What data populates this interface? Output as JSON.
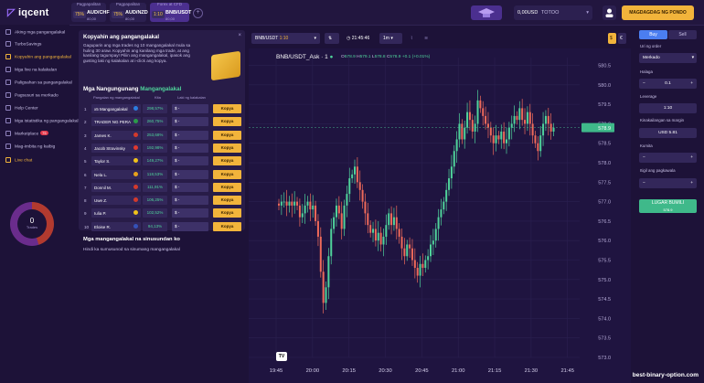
{
  "brand": {
    "name": "iqcent"
  },
  "asset_tabs": [
    {
      "header": "Pagpapalitan",
      "percent": "75%",
      "name": "AUD/CHF",
      "sub": "80,00"
    },
    {
      "header": "Pagpapalitan",
      "percent": "75%",
      "name": "AUD/NZD",
      "sub": "80,00"
    },
    {
      "header": "Forex at CFD",
      "percent": "1:10",
      "name": "BNB/USDT",
      "sub": "80,00"
    }
  ],
  "balance": {
    "amount": "0,00USD",
    "type": "TOTOO"
  },
  "deposit_label": "MAGDAGDAG NG PONDO",
  "sidebar": {
    "items": [
      {
        "label": "Aking mga pangangalakal"
      },
      {
        "label": "TurboSavings"
      },
      {
        "label": "Kopyahin ang pangangalakal",
        "highlight": true
      },
      {
        "label": "Mga live na kalakalan"
      },
      {
        "label": "Paligsahan sa pangangalakal"
      },
      {
        "label": "Pagsusuri sa merkado"
      },
      {
        "label": "Help Center"
      },
      {
        "label": "Mga istatistika ng pangangalakal"
      },
      {
        "label": "Marketplace",
        "badge": "75"
      },
      {
        "label": "Mag-imbita ng kaibig"
      },
      {
        "label": "Live chat",
        "highlight": true
      }
    ],
    "trades_count": "0",
    "trades_label": "Trades"
  },
  "copy_panel": {
    "title": "Kopyahin ang pangangalakal",
    "description": "Gaguparin ang mga trades ng 10 mangangalakal mula sa huling 30 araw. Kopyahin ang kanilang mga trade, at ang kanilang tagumpay! Piliin ang mangangalakal, ipasok ang gusting laki ng kalakalan at i-click ang kopya.",
    "top_title": "Mga Nangungunang",
    "top_title_accent": "Mangangalakal",
    "columns": [
      "Pangalan ng mangangalakal",
      "Kita",
      "Laki ng kalakalan"
    ],
    "rows": [
      {
        "rank": "1",
        "name": "x5 Mangangalakal",
        "flag_color": "#2b7de0",
        "pct": "298,57%",
        "amount": "$ -",
        "copy": "Kopya"
      },
      {
        "rank": "2",
        "name": "TRADER NG PERA",
        "flag_color": "#2b9a4a",
        "pct": "260,75%",
        "amount": "$ -",
        "copy": "Kopya"
      },
      {
        "rank": "3",
        "name": "James K.",
        "flag_color": "#d33a2c",
        "pct": "253,68%",
        "amount": "$ -",
        "copy": "Kopya"
      },
      {
        "rank": "4",
        "name": "Jacob Stravinsky",
        "flag_color": "#e0392f",
        "pct": "192,98%",
        "amount": "$ -",
        "copy": "Kopya"
      },
      {
        "rank": "5",
        "name": "Taylor S.",
        "flag_color": "#f0c21a",
        "pct": "149,27%",
        "amount": "$ -",
        "copy": "Kopya"
      },
      {
        "rank": "6",
        "name": "Nela L.",
        "flag_color": "#e8a21c",
        "pct": "118,53%",
        "amount": "$ -",
        "copy": "Kopya"
      },
      {
        "rank": "7",
        "name": "Donnil M.",
        "flag_color": "#d33a2c",
        "pct": "111,91%",
        "amount": "$ -",
        "copy": "Kopya"
      },
      {
        "rank": "8",
        "name": "Uwe Z.",
        "flag_color": "#d33a2c",
        "pct": "106,25%",
        "amount": "$ -",
        "copy": "Kopya"
      },
      {
        "rank": "9",
        "name": "Iulia P.",
        "flag_color": "#f0c21a",
        "pct": "102,52%",
        "amount": "$ -",
        "copy": "Kopya"
      },
      {
        "rank": "10",
        "name": "Eloise R.",
        "flag_color": "#3552b8",
        "pct": "94,13%",
        "amount": "$ -",
        "copy": "Kopya"
      }
    ],
    "followed_title": "Mga mangangalakal na sinusundan ko",
    "followed_empty": "Hindi ka sumusunod sa sinumang mangangalakal"
  },
  "chart_toolbar": {
    "pair": "BNB/USDT",
    "leverage": "1:10",
    "time": "21:45:46",
    "interval": "1m"
  },
  "chart_header": {
    "symbol": "BNB/USDT_Ask · 1",
    "o": "578.9",
    "h": "579.1",
    "l": "578.8",
    "c": "578.9",
    "change": "+0.1 (+0.01%)"
  },
  "chart_data": {
    "type": "candlestick",
    "title": "BNB/USDT_Ask · 1",
    "ylim": [
      573.0,
      580.7
    ],
    "yticks": [
      "580.5",
      "580.0",
      "579.5",
      "579.0",
      "578.5",
      "578.0",
      "577.5",
      "577.0",
      "576.5",
      "576.0",
      "575.5",
      "575.0",
      "574.5",
      "574.0",
      "573.5",
      "573.0"
    ],
    "xticks": [
      "19:45",
      "20:00",
      "20:15",
      "20:30",
      "20:45",
      "21:00",
      "21:15",
      "21:30",
      "21:45"
    ],
    "xlim_minutes": [
      0,
      125
    ],
    "xtick_minutes": [
      0,
      15,
      30,
      45,
      60,
      75,
      90,
      105,
      120
    ],
    "current_price": "578.9",
    "series": [
      {
        "name": "BNB/USDT_Ask",
        "closes": [
          576.9,
          577.0,
          577.0,
          576.9,
          577.0,
          576.9,
          577.0,
          576.9,
          576.6,
          576.7,
          576.9,
          577.0,
          576.8,
          576.9,
          576.5,
          576.1,
          575.2,
          574.4,
          574.8,
          575.6,
          576.3,
          576.6,
          576.9,
          576.7,
          576.3,
          576.9,
          577.2,
          577.6,
          577.7,
          577.9,
          577.5,
          577.3,
          577.0,
          576.7,
          576.4,
          576.2,
          576.3,
          576.0,
          576.2,
          575.9,
          576.1,
          576.4,
          576.7,
          576.4,
          576.6,
          576.3,
          576.1,
          575.8,
          575.6,
          575.9,
          575.8,
          575.5,
          575.3,
          575.1,
          575.4,
          575.3,
          575.5,
          575.6,
          575.9,
          576.0,
          576.3,
          576.6,
          576.8,
          577.0,
          577.3,
          577.6,
          577.9,
          578.3,
          578.6,
          579.0,
          578.6,
          578.9,
          579.3,
          579.1,
          578.8,
          579.0,
          579.6,
          579.4,
          579.2,
          579.0,
          578.9,
          578.7,
          578.5,
          578.7,
          578.6,
          578.8,
          578.5,
          578.6,
          578.9,
          579.0,
          579.2,
          579.1,
          579.4,
          579.1,
          579.0,
          579.3,
          579.0,
          578.7,
          578.5,
          578.3,
          578.7,
          579.0,
          579.2,
          579.0,
          578.8,
          578.9
        ]
      }
    ]
  },
  "right_panel": {
    "tab_buy": "Buy",
    "tab_sell": "Sell",
    "order_type_label": "Uri ng order",
    "order_type": "Merkado",
    "amount_label": "Halaga",
    "amount": "0.1",
    "leverage_label": "Leverage",
    "leverage": "1:10",
    "margin_label": "Kinakailangan sa margin",
    "margin": "USD 5.81",
    "tp_label": "Kumita",
    "sl_label": "Itigil ang pagkawala",
    "submit": "LUGAR BUMILI",
    "submit_price": "578.9"
  },
  "watermark": "best-binary-option.com",
  "tradingview": "TV"
}
